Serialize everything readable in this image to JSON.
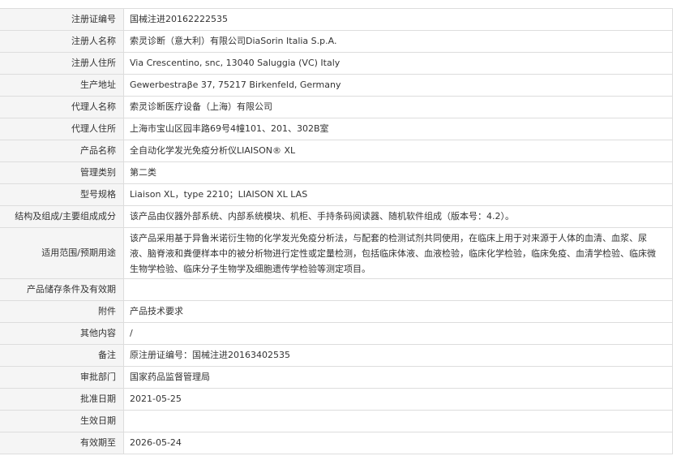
{
  "rows": [
    {
      "label": "注册证编号",
      "value": "国械注进20162222535"
    },
    {
      "label": "注册人名称",
      "value": "索灵诊断（意大利）有限公司DiaSorin Italia S.p.A."
    },
    {
      "label": "注册人住所",
      "value": "Via Crescentino, snc, 13040 Saluggia (VC) Italy"
    },
    {
      "label": "生产地址",
      "value": "Gewerbestraβe 37, 75217 Birkenfeld, Germany"
    },
    {
      "label": "代理人名称",
      "value": "索灵诊断医疗设备（上海）有限公司"
    },
    {
      "label": "代理人住所",
      "value": "上海市宝山区园丰路69号4幢101、201、302B室"
    },
    {
      "label": "产品名称",
      "value": "全自动化学发光免疫分析仪LIAISON® XL"
    },
    {
      "label": "管理类别",
      "value": "第二类"
    },
    {
      "label": "型号规格",
      "value": "Liaison XL，type 2210；LIAISON XL LAS"
    },
    {
      "label": "结构及组成/主要组成成分",
      "value": "该产品由仪器外部系统、内部系统模块、机柜、手持条码阅读器、随机软件组成（版本号：4.2）。"
    },
    {
      "label": "适用范围/预期用途",
      "value": "该产品采用基于异鲁米诺衍生物的化学发光免疫分析法，与配套的检测试剂共同使用，在临床上用于对来源于人体的血清、血浆、尿液、脑脊液和粪便样本中的被分析物进行定性或定量检测，包括临床体液、血液检验，临床化学检验，临床免疫、血清学检验、临床微生物学检验、临床分子生物学及细胞遗传学检验等测定项目。"
    },
    {
      "label": "产品储存条件及有效期",
      "value": ""
    },
    {
      "label": "附件",
      "value": "产品技术要求"
    },
    {
      "label": "其他内容",
      "value": "/"
    },
    {
      "label": "备注",
      "value": "原注册证编号：国械注进20163402535"
    },
    {
      "label": "审批部门",
      "value": "国家药品监督管理局"
    },
    {
      "label": "批准日期",
      "value": "2021-05-25"
    },
    {
      "label": "生效日期",
      "value": ""
    },
    {
      "label": "有效期至",
      "value": "2026-05-24"
    }
  ]
}
